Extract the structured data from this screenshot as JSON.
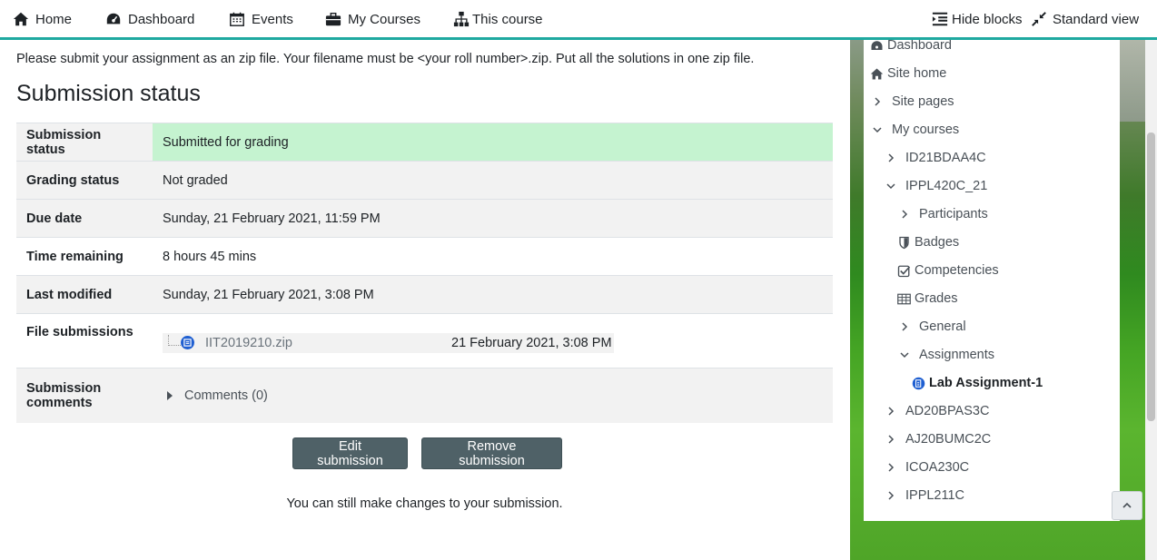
{
  "navbar": {
    "home": "Home",
    "dashboard": "Dashboard",
    "events": "Events",
    "my_courses": "My Courses",
    "this_course": "This course",
    "hide_blocks": "Hide blocks",
    "standard_view": "Standard view"
  },
  "intro": "Please submit your assignment as an zip file. Your filename must be <your roll number>.zip. Put all the solutions in one zip file.",
  "heading": "Submission status",
  "status_table": {
    "submission_status": {
      "label": "Submission status",
      "value": "Submitted for grading"
    },
    "grading_status": {
      "label": "Grading status",
      "value": "Not graded"
    },
    "due_date": {
      "label": "Due date",
      "value": "Sunday, 21 February 2021, 11:59 PM"
    },
    "time_remaining": {
      "label": "Time remaining",
      "value": "8 hours 45 mins"
    },
    "last_modified": {
      "label": "Last modified",
      "value": "Sunday, 21 February 2021, 3:08 PM"
    },
    "file_submissions": {
      "label": "File submissions",
      "file_name": "IIT2019210.zip",
      "file_date": "21 February 2021, 3:08 PM"
    },
    "submission_comments": {
      "label": "Submission comments",
      "value": "Comments (0)"
    }
  },
  "buttons": {
    "edit": "Edit submission",
    "remove": "Remove submission"
  },
  "note": "You can still make changes to your submission.",
  "nav_tree": {
    "dashboard": "Dashboard",
    "site_home": "Site home",
    "site_pages": "Site pages",
    "my_courses": "My courses",
    "course1": "ID21BDAA4C",
    "course2": "IPPL420C_21",
    "participants": "Participants",
    "badges": "Badges",
    "competencies": "Competencies",
    "grades": "Grades",
    "general": "General",
    "assignments": "Assignments",
    "lab_assignment": "Lab Assignment-1",
    "course3": "AD20BPAS3C",
    "course4": "AJ20BUMC2C",
    "course5": "ICOA230C",
    "course6": "IPPL211C"
  },
  "colors": {
    "accent": "#1fa9a0",
    "submitted_bg": "#c5f3d0",
    "button_bg": "#4f6167",
    "file_icon": "#1f5fd1"
  }
}
